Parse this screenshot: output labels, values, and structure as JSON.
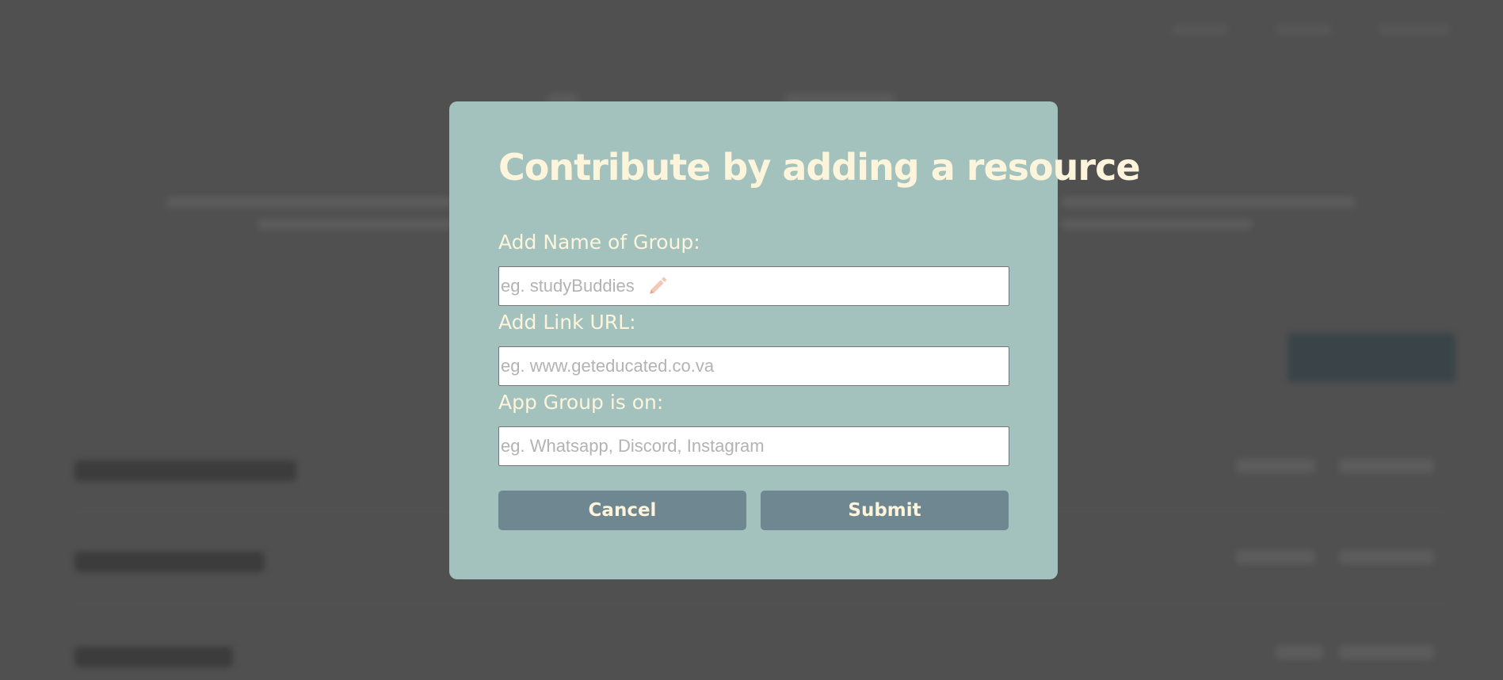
{
  "modal": {
    "title": "Contribute by adding a resource",
    "fields": [
      {
        "label": "Add Name of Group:",
        "placeholder": "eg. studyBuddies",
        "value": ""
      },
      {
        "label": "Add Link URL:",
        "placeholder": "eg. www.geteducated.co.va",
        "value": ""
      },
      {
        "label": "App Group is on:",
        "placeholder": "eg. Whatsapp, Discord, Instagram",
        "value": ""
      }
    ],
    "buttons": {
      "cancel": "Cancel",
      "submit": "Submit"
    }
  },
  "colors": {
    "modal_bg": "#a3c2bd",
    "modal_text": "#fdf4dc",
    "button_bg": "#6f8790",
    "overlay": "#505050",
    "pencil_icon": "#f2c9b8"
  },
  "icons": {
    "name_field_icon": "pencil-icon"
  }
}
